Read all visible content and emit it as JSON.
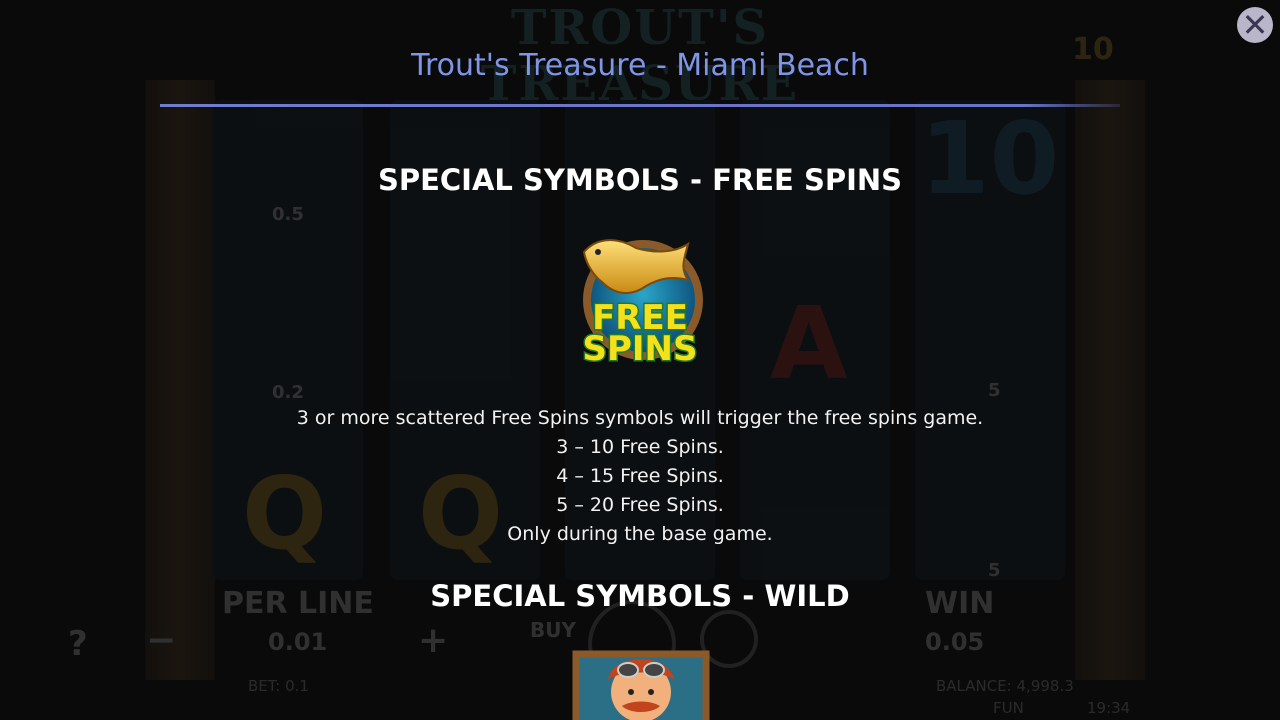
{
  "background": {
    "logo": "TROUT'S TREASURE",
    "reel_values": [
      "0.5",
      "0.2",
      "5",
      "5"
    ],
    "reel_letters": [
      "Q",
      "Q",
      "A"
    ],
    "big_number": "10",
    "corner_number": "10",
    "hud": {
      "per_line_label": "PER LINE",
      "per_line_value": "0.01",
      "win_label": "WIN",
      "win_value": "0.05",
      "buy_label": "BUY",
      "bet_text": "BET: 0.1",
      "balance_text": "BALANCE: 4,998.3",
      "fun_text": "FUN",
      "clock_text": "19:34",
      "help_symbol": "?",
      "minus_symbol": "−",
      "plus_symbol": "+"
    }
  },
  "dialog": {
    "title": "Trout's Treasure - Miami Beach",
    "close_symbol": "✕",
    "sections": [
      {
        "heading": "SPECIAL SYMBOLS - FREE SPINS",
        "icon": "free-spins-fish-icon",
        "icon_text_line1": "FREE",
        "icon_text_line2": "SPINS",
        "lines": [
          "3 or more scattered Free Spins symbols will trigger the free spins game.",
          "3 – 10 Free Spins.",
          "4 – 15 Free Spins.",
          "5 – 20 Free Spins.",
          "Only during the base game."
        ]
      },
      {
        "heading": "SPECIAL SYMBOLS - WILD",
        "icon": "fisherman-wild-icon"
      }
    ]
  },
  "colors": {
    "title": "#7f95e6",
    "rule": "#6b74c9",
    "heading": "#ffffff",
    "body_text": "#f2f2f2",
    "fs_green": "#f4e11b",
    "fs_outline": "#1f7a2a"
  }
}
